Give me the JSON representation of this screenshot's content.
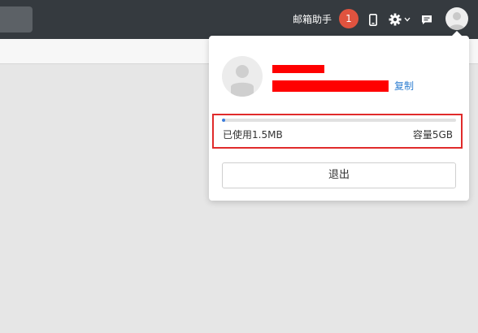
{
  "topbar": {
    "assistant_label": "邮箱助手",
    "notification_count": "1",
    "icons": [
      "phone-icon",
      "gear-icon",
      "chevron-down-icon",
      "message-icon",
      "avatar"
    ]
  },
  "account_popup": {
    "copy_label": "复制",
    "storage": {
      "used_label": "已使用1.5MB",
      "capacity_label": "容量5GB",
      "used_fraction": 0.0003
    },
    "logout_label": "退出"
  },
  "colors": {
    "topbar_bg": "#353a3f",
    "badge": "#e0533f",
    "link": "#2f7fd1",
    "highlight_border": "#e02b2b",
    "progress_fill": "#3b7ddd"
  }
}
